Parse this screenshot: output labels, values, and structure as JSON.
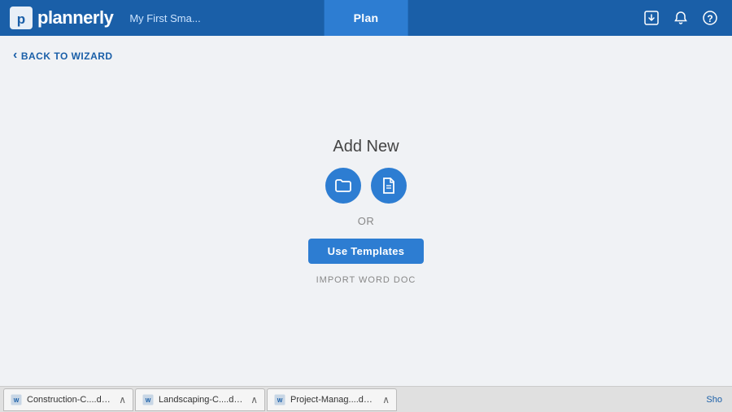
{
  "header": {
    "logo_text": "plannerly",
    "project_title": "My First Sma...",
    "nav_plan_label": "Plan",
    "icon_download": "⬇",
    "icon_bell": "🔔",
    "icon_help": "?"
  },
  "back_bar": {
    "label": "BACK TO WIZARD",
    "chevron": "‹"
  },
  "main": {
    "add_new_title": "Add New",
    "folder_icon_symbol": "🗀",
    "file_icon_symbol": "🗋",
    "or_text": "OR",
    "use_templates_label": "Use Templates",
    "import_word_label": "IMPORT WORD DOC"
  },
  "taskbar": {
    "items": [
      {
        "label": "Construction-C....docx",
        "icon_color": "#1a5fa8"
      },
      {
        "label": "Landscaping-C....docx",
        "icon_color": "#1a5fa8"
      },
      {
        "label": "Project-Manag....docx",
        "icon_color": "#1a5fa8"
      }
    ],
    "show_button_label": "Sho"
  }
}
